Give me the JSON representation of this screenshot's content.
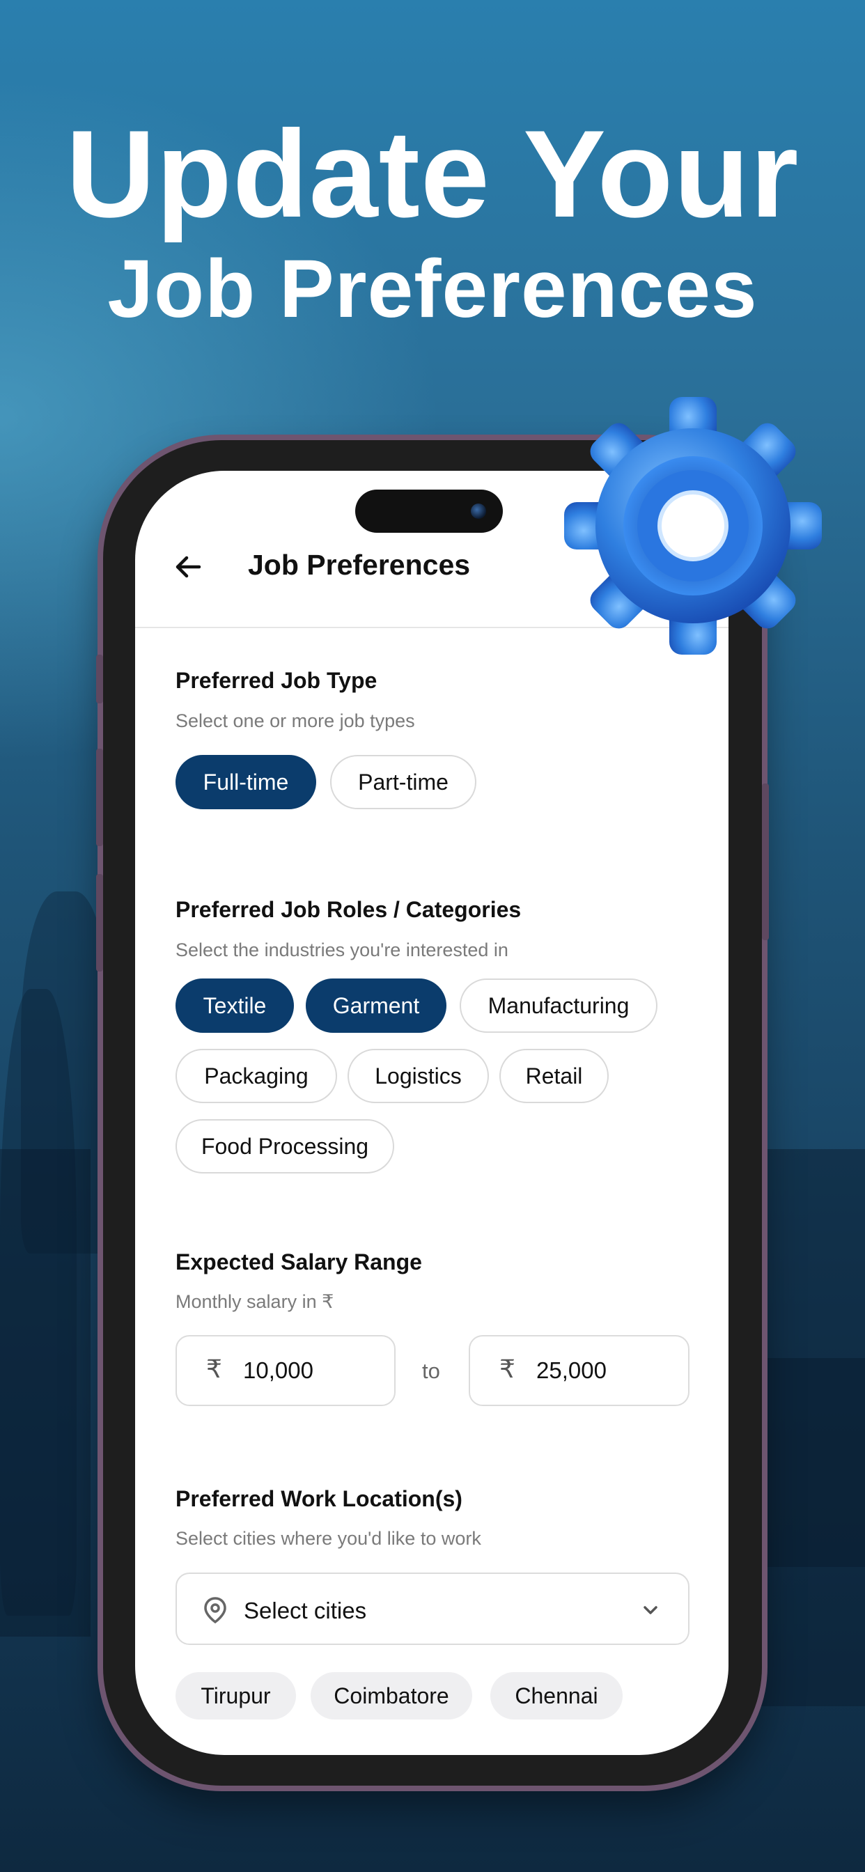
{
  "headline": {
    "line1": "Update Your",
    "line2": "Job Preferences"
  },
  "app": {
    "title": "Job Preferences",
    "job_type": {
      "title": "Preferred Job Type",
      "subtitle": "Select one or more job types",
      "options": [
        {
          "label": "Full-time",
          "selected": true
        },
        {
          "label": "Part-time",
          "selected": false
        }
      ]
    },
    "roles": {
      "title": "Preferred Job Roles / Categories",
      "subtitle": "Select the industries you're interested in",
      "options": [
        {
          "label": "Textile",
          "selected": true
        },
        {
          "label": "Garment",
          "selected": true
        },
        {
          "label": "Manufacturing",
          "selected": false
        },
        {
          "label": "Packaging",
          "selected": false
        },
        {
          "label": "Logistics",
          "selected": false
        },
        {
          "label": "Retail",
          "selected": false
        },
        {
          "label": "Food Processing",
          "selected": false
        }
      ]
    },
    "salary": {
      "title": "Expected Salary Range",
      "subtitle": "Monthly salary in ₹",
      "currency_symbol": "₹",
      "min_value": "10,000",
      "to_label": "to",
      "max_value": "25,000"
    },
    "location": {
      "title": "Preferred Work Location(s)",
      "subtitle": "Select cities where you'd like to work",
      "select_placeholder": "Select cities",
      "cities": [
        "Tirupur",
        "Coimbatore",
        "Chennai"
      ]
    }
  },
  "colors": {
    "accent": "#0b3c6c",
    "gear": "#2f7fe0"
  }
}
